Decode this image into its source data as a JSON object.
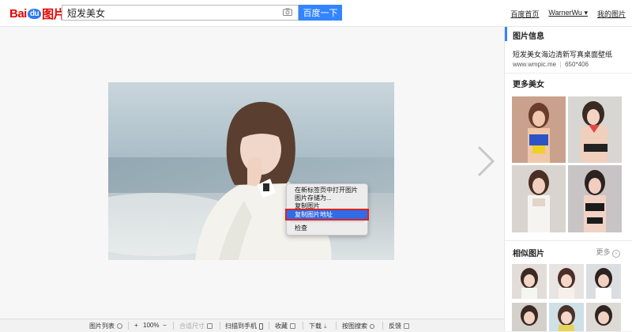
{
  "header": {
    "logo_part1": "Bai",
    "logo_part2": "du",
    "logo_part3": "图片",
    "search_value": "短发美女",
    "search_button": "百度一下",
    "links": [
      "百度首页",
      "WarnerWu",
      "我的图片"
    ]
  },
  "context_menu": {
    "items": [
      "在新标签页中打开图片",
      "图片存储为...",
      "复制图片",
      "复制图片地址",
      "检查"
    ],
    "selected_index": 3,
    "accent_color": "#2f6ce8",
    "highlight_border": "#e02020"
  },
  "sidebar": {
    "info_heading": "图片信息",
    "info_title": "短发美女海边清新写真桌面壁纸",
    "info_source": "www.wmpic.me",
    "info_separator": "|",
    "info_size": "650*406",
    "more_heading": "更多美女",
    "similar_heading": "相似图片",
    "similar_more": "更多",
    "accent_color": "#3385ff"
  },
  "toolbar": {
    "list": "图片列表",
    "zoom_in": "+",
    "zoom_level": "100%",
    "zoom_out": "−",
    "fit": "合适尺寸",
    "scan": "扫描到手机",
    "collect": "收藏",
    "download": "下载",
    "search_by_image": "按图搜索",
    "feedback": "反馈"
  }
}
